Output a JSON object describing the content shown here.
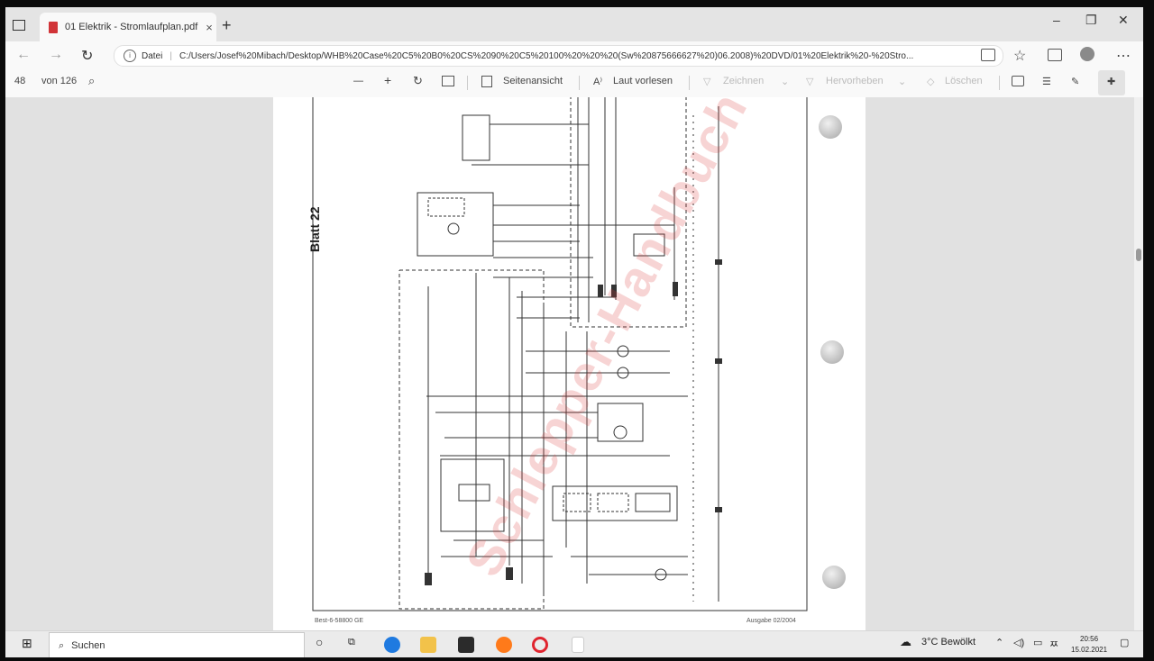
{
  "browser": {
    "tab_title": "01 Elektrik - Stromlaufplan.pdf",
    "tab_close": "×",
    "new_tab": "+",
    "window_controls": {
      "minimize": "–",
      "restore": "❐",
      "close": "✕"
    },
    "address": {
      "info_label": "Datei",
      "url": "C:/Users/Josef%20Mibach/Desktop/WHB%20Case%20C5%20B0%20CS%2090%20C5%20100%20%20%20(Sw%20875666627%20)06.2008)%20DVD/01%20Elektrik%20-%20Stro..."
    }
  },
  "pdf_toolbar": {
    "page_current": "48",
    "page_total": "von 126",
    "zoom_out": "—",
    "zoom_in": "+",
    "page_view_label": "Seitenansicht",
    "read_aloud_label": "Laut vorlesen",
    "draw_label": "Zeichnen",
    "highlight_label": "Hervorheben",
    "erase_label": "Löschen"
  },
  "document": {
    "sheet_label": "Blatt 22",
    "watermark": "Schlepper-Handbuch",
    "footer_left": "Best-6-58800 GE",
    "footer_right": "Ausgabe 02/2004"
  },
  "taskbar": {
    "search_placeholder": "Suchen",
    "weather": "3°C  Bewölkt",
    "time": "20:56",
    "date": "15.02.2021"
  }
}
